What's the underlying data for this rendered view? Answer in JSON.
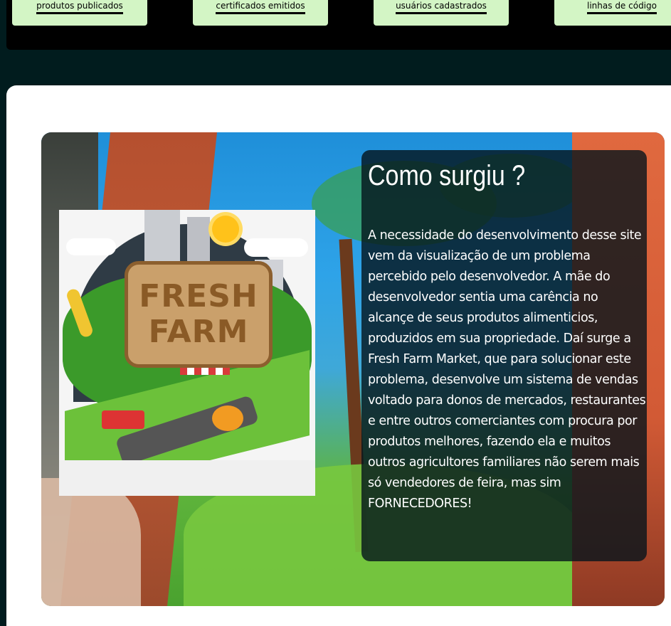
{
  "stats": [
    {
      "label": "produtos publicados"
    },
    {
      "label": "certificados emitidos"
    },
    {
      "label": "usuários cadastrados"
    },
    {
      "label": "linhas de código"
    }
  ],
  "colors": {
    "page_background": "#011c1e",
    "stat_card": "#d3f5c5",
    "section_background": "#ffffff",
    "info_panel": "#05141c"
  },
  "origin": {
    "artwork": {
      "sign_line_1": "FRESH",
      "sign_line_2": "FARM"
    },
    "title": "Como surgiu ?",
    "text": "A necessidade do desenvolvimento desse site vem da visualização de um problema percebido pelo desenvolvedor. A mãe do desenvolvedor sentia uma carência no alcançe de seus produtos alimenticios, produzidos em sua propriedade. Daí surge a Fresh Farm Market, que para solucionar este problema, desenvolve um sistema de vendas voltado para donos de mercados, restaurantes e entre outros comerciantes com procura por produtos melhores, fazendo ela e muitos outros agricultores familiares não serem mais só vendedores de feira, mas sim FORNECEDORES!"
  }
}
